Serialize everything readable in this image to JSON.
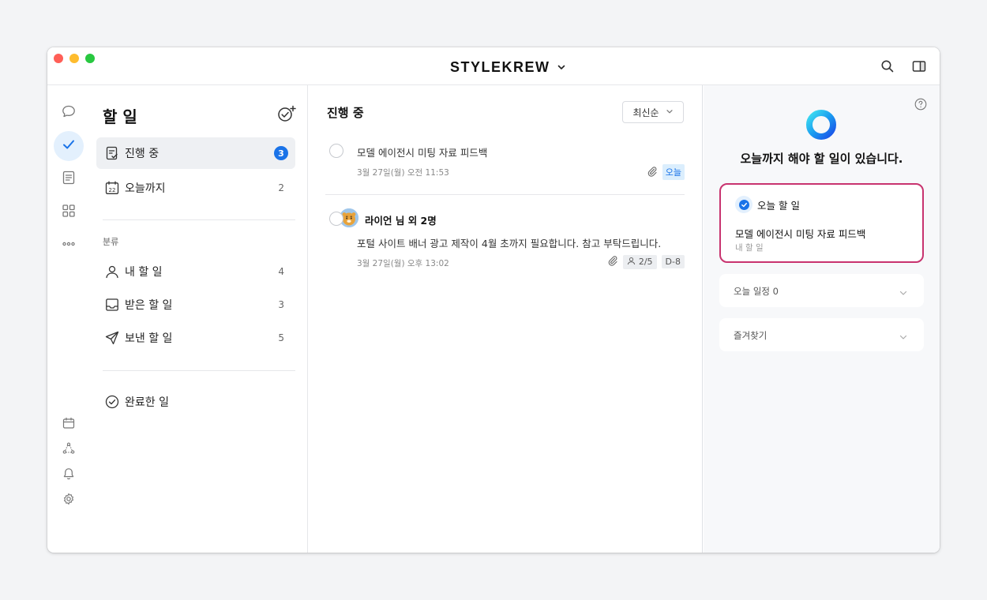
{
  "window": {
    "brand": "STYLEKREW"
  },
  "nav": {
    "title": "할 일",
    "items": [
      {
        "label": "진행 중",
        "count": "3"
      },
      {
        "label": "오늘까지",
        "count": "2"
      }
    ],
    "section_label": "분류",
    "categories": [
      {
        "label": "내 할 일",
        "count": "4"
      },
      {
        "label": "받은 할 일",
        "count": "3"
      },
      {
        "label": "보낸 할 일",
        "count": "5"
      }
    ],
    "completed_label": "완료한 일",
    "calendar_day": "22"
  },
  "list": {
    "title": "진행 중",
    "sort_label": "최신순",
    "tasks": [
      {
        "title": "모델 에이전시 미팅 자료 피드백",
        "date": "3월 27일(월) 오전 11:53",
        "tag": "오늘"
      },
      {
        "assignee": "라이언 님 외 2명",
        "title": "포털 사이트 배너 광고 제작이 4월 초까지 필요합니다. 참고 부탁드립니다.",
        "date": "3월 27일(월) 오후 13:02",
        "progress": "2/5",
        "dday": "D-8"
      }
    ]
  },
  "right": {
    "heading": "오늘까지 해야 할 일이 있습니다.",
    "today_card": {
      "title": "오늘 할 일",
      "task": "모델 에이전시 미팅 자료 피드백",
      "sub": "내 할 일"
    },
    "schedule_label": "오늘 일정 0",
    "favorites_label": "즐겨찾기"
  },
  "colors": {
    "accent": "#1a73e8",
    "highlight_border": "#c8336f",
    "today_tag_bg": "#dbeefd"
  }
}
